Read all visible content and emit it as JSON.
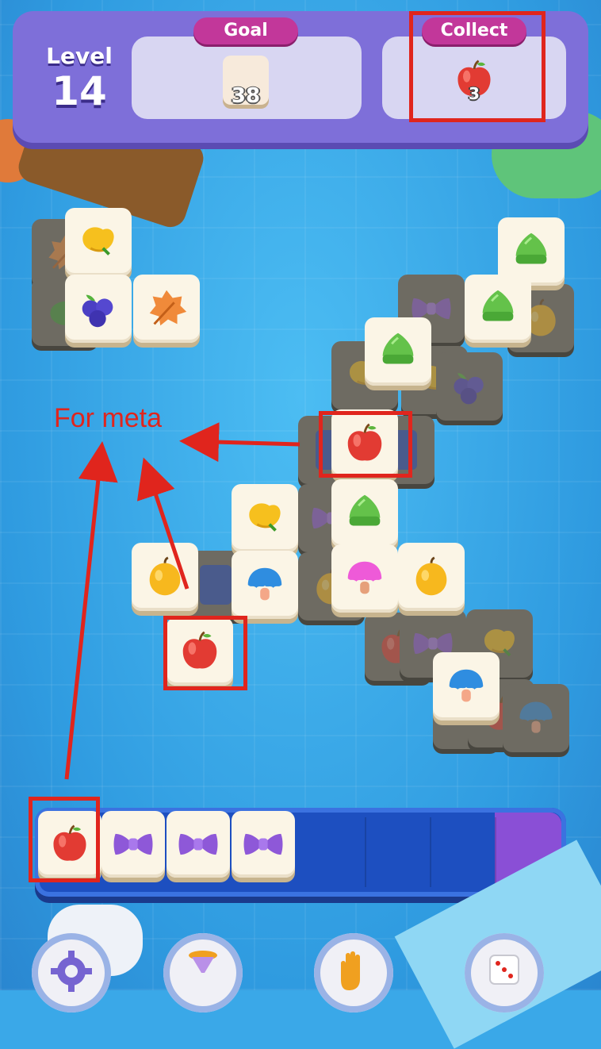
{
  "level": {
    "label": "Level",
    "number": "14"
  },
  "goal": {
    "label": "Goal",
    "count": "38"
  },
  "collect": {
    "label": "Collect",
    "item": "apple-icon",
    "count": "3"
  },
  "annotation": {
    "text": "For meta",
    "color": "#e0251d"
  },
  "board": {
    "tiles": [
      "leaf",
      "tulip",
      "grape",
      "leaf",
      "blueberry",
      "leaf",
      "tulip",
      "cupcake",
      "bow",
      "cupcake",
      "cupcake",
      "blueberry",
      "apple",
      "bow",
      "tulip",
      "cupcake",
      "lemon",
      "mushroom",
      "icecream",
      "apple",
      "lemon",
      "apple",
      "icecream",
      "apple",
      "bow"
    ]
  },
  "tray": {
    "items": [
      "apple",
      "bow",
      "bow",
      "bow"
    ],
    "capacity": 7
  },
  "bottom_buttons": [
    "gear-icon",
    "hourglass-icon",
    "glove-icon",
    "dice-icon"
  ],
  "colors": {
    "header": "#7e6fd9",
    "pill": "#c2379a",
    "tray": "#1d4fc0",
    "highlight": "#e0251d"
  }
}
